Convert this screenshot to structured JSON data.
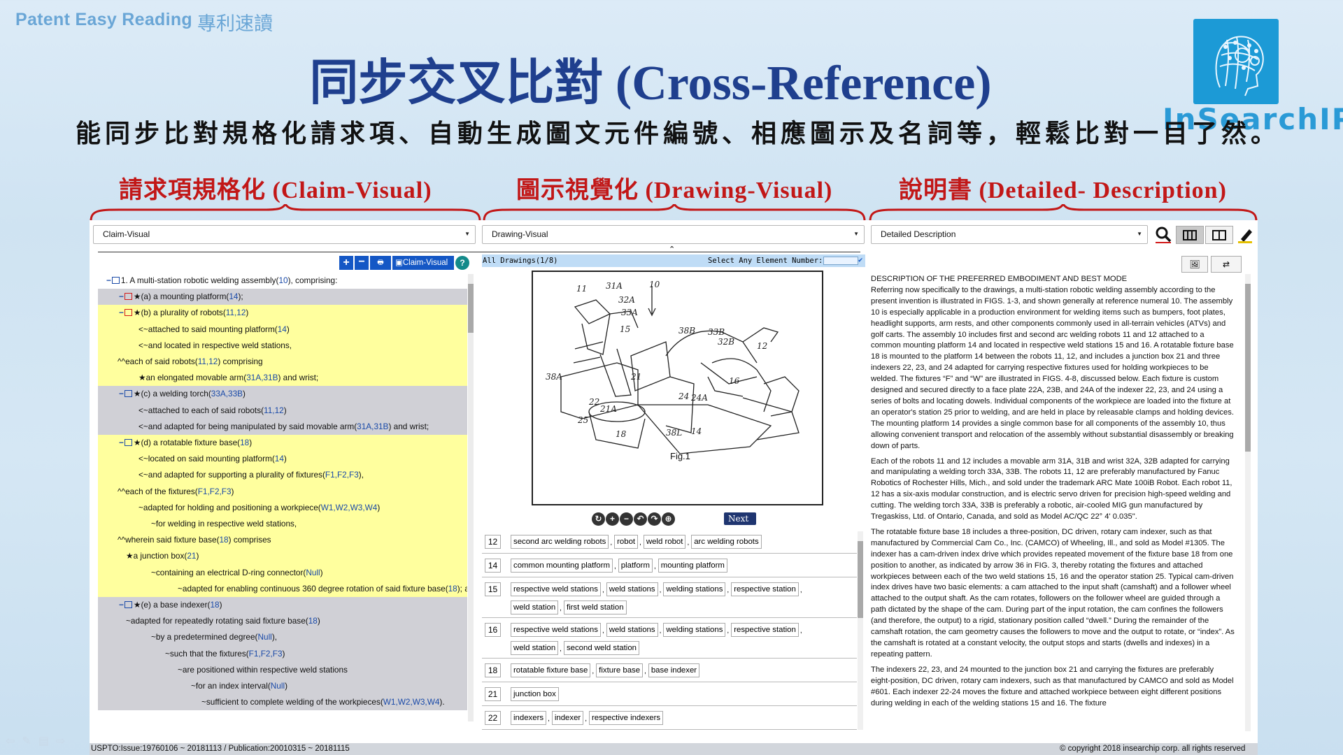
{
  "brand": {
    "en": "Patent Easy Reading",
    "cn": "專利速讀"
  },
  "logo_text": "InSearchIP",
  "title": "同步交叉比對 (Cross-Reference)",
  "subtitle": "能同步比對規格化請求項、自動生成圖文元件編號、相應圖示及名詞等，輕鬆比對一目了然。",
  "sections": {
    "claim": "請求項規格化 (Claim-Visual)",
    "drawing": "圖示視覺化 (Drawing-Visual)",
    "detail": "說明書 (Detailed- Description)"
  },
  "selects": {
    "claim": "Claim-Visual",
    "drawing": "Drawing-Visual",
    "detail": "Detailed Description"
  },
  "claim_toolbar": {
    "label": "Claim-Visual"
  },
  "claims": {
    "r1": "1. A multi-station robotic welding assembly(",
    "r1n": "10",
    "r1e": "), comprising:",
    "r2": "★(a) a mounting platform(",
    "r2n": "14",
    "r2e": ");",
    "r3": "★(b) a plurality of robots(",
    "r3n": "11,12",
    "r3e": ")",
    "r4": "<~attached to said mounting platform(",
    "r4n": "14",
    "r4e": ")",
    "r5": "<~and located in respective weld stations,",
    "r6": "^^each of said robots(",
    "r6n": "11,12",
    "r6e": ") comprising",
    "r7": "★an elongated movable arm(",
    "r7n": "31A,31B",
    "r7e": ") and wrist;",
    "r8": "★(c) a welding torch(",
    "r8n": "33A,33B",
    "r8e": ")",
    "r9": "<~attached to each of said robots(",
    "r9n": "11,12",
    "r9e": ")",
    "r10": "<~and adapted for being manipulated by said movable arm(",
    "r10n": "31A,31B",
    "r10e": ") and wrist;",
    "r11": "★(d) a rotatable fixture base(",
    "r11n": "18",
    "r11e": ")",
    "r12": "<~located on said mounting platform(",
    "r12n": "14",
    "r12e": ")",
    "r13": "<~and adapted for supporting a plurality of fixtures(",
    "r13n": "F1,F2,F3",
    "r13e": "),",
    "r14": "^^each of the fixtures(",
    "r14n": "F1,F2,F3",
    "r14e": ")",
    "r15": "~adapted for holding and positioning a workpiece(",
    "r15n": "W1,W2,W3,W4",
    "r15e": ")",
    "r16": "~for welding in respective weld stations,",
    "r17": "^^wherein said fixture base(",
    "r17n": "18",
    "r17e": ") comprises",
    "r18": "★a junction box(",
    "r18n": "21",
    "r18e": ")",
    "r19": "~containing an electrical D-ring connector(",
    "r19n": "Null",
    "r19e": ")",
    "r20": "~adapted for enabling continuous 360 degree rotation of said fixture base(",
    "r20n": "18",
    "r20e": "); and",
    "r21": "★(e) a base indexer(",
    "r21n": "18",
    "r21e": ")",
    "r22": "~adapted for repeatedly rotating said fixture base(",
    "r22n": "18",
    "r22e": ")",
    "r23": "~by a predetermined degree(",
    "r23n": "Null",
    "r23e": "),",
    "r24": "~such that the fixtures(",
    "r24n": "F1,F2,F3",
    "r24e": ")",
    "r25": "~are positioned within respective weld stations",
    "r26": "~for an index interval(",
    "r26n": "Null",
    "r26e": ")",
    "r27": "~sufficient to complete welding of the workpieces(",
    "r27n": "W1,W2,W3,W4",
    "r27e": ")."
  },
  "drawing": {
    "all": "All Drawings(1/8)",
    "select_label": "Select Any Element Number:",
    "fig": "Fig.1",
    "next": "Next",
    "labels": [
      "11",
      "31A",
      "10",
      "32A",
      "33A",
      "15",
      "38B",
      "33B",
      "32B",
      "12",
      "38A",
      "16",
      "21",
      "22",
      "21A",
      "24",
      "24A",
      "25",
      "18",
      "38L",
      "14"
    ]
  },
  "groups": [
    {
      "n": "12",
      "tags": [
        "second arc welding robots",
        "robot",
        "weld robot",
        "arc welding robots"
      ]
    },
    {
      "n": "14",
      "tags": [
        "common mounting platform",
        "platform",
        "mounting platform"
      ]
    },
    {
      "n": "15",
      "tags": [
        "respective weld stations",
        "weld stations",
        "welding stations",
        "respective station",
        "weld station",
        "first weld station"
      ]
    },
    {
      "n": "16",
      "tags": [
        "respective weld stations",
        "weld stations",
        "welding stations",
        "respective station",
        "weld station",
        "second weld station"
      ]
    },
    {
      "n": "18",
      "tags": [
        "rotatable fixture base",
        "fixture base",
        "base indexer"
      ]
    },
    {
      "n": "21",
      "tags": [
        "junction box"
      ]
    },
    {
      "n": "22",
      "tags": [
        "indexers",
        "indexer",
        "respective indexers"
      ]
    }
  ],
  "description": {
    "heading": "DESCRIPTION OF THE PREFERRED EMBODIMENT AND BEST MODE",
    "p1": "Referring now specifically to the drawings, a multi-station robotic welding assembly according to the present invention is illustrated in FIGS. 1-3, and shown generally at reference numeral 10. The assembly 10 is especially applicable in a production environment for welding items such as bumpers, foot plates, headlight supports, arm rests, and other components commonly used in all-terrain vehicles (ATVs) and golf carts. The assembly 10 includes first and second arc welding robots 11 and 12 attached to a common mounting platform 14 and located in respective weld stations 15 and 16. A rotatable fixture base 18 is mounted to the platform 14 between the robots 11, 12, and includes a junction box 21 and three indexers 22, 23, and 24 adapted for carrying respective fixtures used for holding workpieces to be welded. The fixtures “F” and “W” are illustrated in FIGS. 4-8, discussed below. Each fixture is custom designed and secured directly to a face plate 22A, 23B, and 24A of the indexer 22, 23, and 24 using a series of bolts and locating dowels. Individual components of the workpiece are loaded into the fixture at an operator's station 25 prior to welding, and are held in place by releasable clamps and holding devices. The mounting platform 14 provides a single common base for all components of the assembly 10, thus allowing convenient transport and relocation of the assembly without substantial disassembly or breaking down of parts.",
    "p2": "Each of the robots 11 and 12 includes a movable arm 31A, 31B and wrist 32A, 32B adapted for carrying and manipulating a welding torch 33A, 33B. The robots 11, 12 are preferably manufactured by Fanuc Robotics of Rochester Hills, Mich., and sold under the trademark ARC Mate 100iB Robot. Each robot 11, 12 has a six-axis modular construction, and is electric servo driven for precision high-speed welding and cutting. The welding torch 33A, 33B is preferably a robotic, air-cooled MIG gun manufactured by Tregaskiss, Ltd. of Ontario, Canada, and sold as Model AC/QC 22° 4' 0.035\".",
    "p3": "The rotatable fixture base 18 includes a three-position, DC driven, rotary cam indexer, such as that manufactured by Commercial Cam Co., Inc. (CAMCO) of Wheeling, Ill., and sold as Model #1305. The indexer has a cam-driven index drive which provides repeated movement of the fixture base 18 from one position to another, as indicated by arrow 36 in FIG. 3, thereby rotating the fixtures and attached workpieces between each of the two weld stations 15, 16 and the operator station 25. Typical cam-driven index drives have two basic elements: a cam attached to the input shaft (camshaft) and a follower wheel attached to the output shaft. As the cam rotates, followers on the follower wheel are guided through a path dictated by the shape of the cam. During part of the input rotation, the cam confines the followers (and therefore, the output) to a rigid, stationary position called “dwell.” During the remainder of the camshaft rotation, the cam geometry causes the followers to move and the output to rotate, or “index”. As the camshaft is rotated at a constant velocity, the output stops and starts (dwells and indexes) in a repeating pattern.",
    "p4": "The indexers 22, 23, and 24 mounted to the junction box 21 and carrying the fixtures are preferably eight-position, DC driven, rotary cam indexers, such as that manufactured by CAMCO and sold as Model #601. Each indexer 22-24 moves the fixture and attached workpiece between eight different positions during welding in each of the welding stations 15 and 16. The fixture"
  },
  "footer": {
    "left": "USPTO:Issue:19760106 ~ 20181113 / Publication:20010315 ~ 20181115",
    "right": "© copyright 2018 insearchip corp. all rights reserved"
  },
  "colors": {
    "title": "#1f3f8e",
    "section": "#c21717",
    "highlight": "#ffff9e",
    "group_gray": "#d0d0d6",
    "link": "#1a4aa8"
  }
}
